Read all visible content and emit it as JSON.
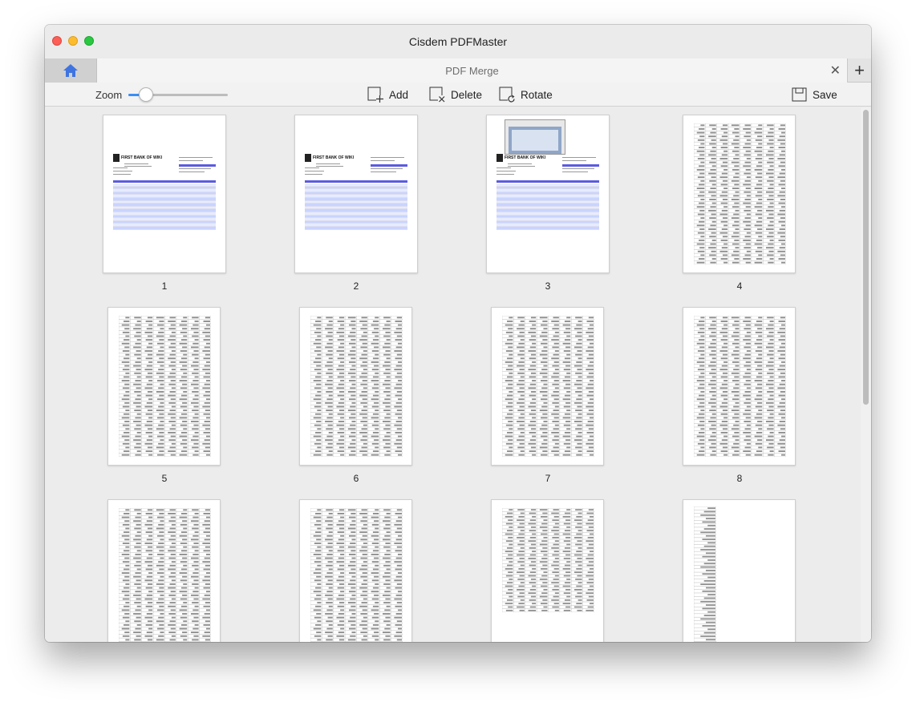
{
  "window": {
    "title": "Cisdem PDFMaster"
  },
  "tabs": {
    "home_icon": "home-icon",
    "active_label": "PDF Merge",
    "close_icon": "close-icon",
    "add_icon": "plus-icon"
  },
  "toolbar": {
    "zoom_label": "Zoom",
    "zoom_level": 0.18,
    "add_label": "Add",
    "delete_label": "Delete",
    "rotate_label": "Rotate",
    "save_label": "Save"
  },
  "pages": [
    {
      "number": "1",
      "kind": "statement"
    },
    {
      "number": "2",
      "kind": "statement"
    },
    {
      "number": "3",
      "kind": "statement-screenshot"
    },
    {
      "number": "4",
      "kind": "table"
    },
    {
      "number": "5",
      "kind": "table"
    },
    {
      "number": "6",
      "kind": "table"
    },
    {
      "number": "7",
      "kind": "table"
    },
    {
      "number": "8",
      "kind": "table"
    },
    {
      "number": "",
      "kind": "table"
    },
    {
      "number": "",
      "kind": "table"
    },
    {
      "number": "",
      "kind": "table-short"
    },
    {
      "number": "",
      "kind": "single-column"
    }
  ],
  "statement_text": {
    "bank_name": "FIRST BANK OF WIKI"
  },
  "colors": {
    "accent": "#3a8ef6",
    "statement_header": "#5c5ce0",
    "home_icon": "#3f74e0"
  }
}
